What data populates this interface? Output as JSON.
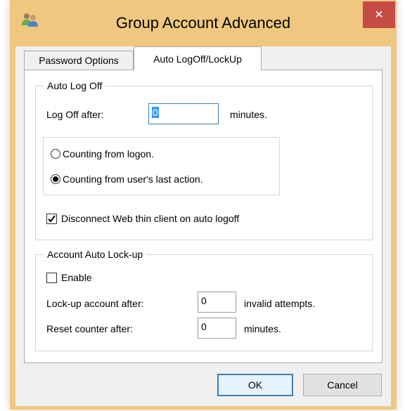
{
  "window": {
    "title": "Group Account Advanced",
    "close_glyph": "✕"
  },
  "tabs": [
    {
      "label": "Password Options",
      "active": false
    },
    {
      "label": "Auto LogOff/LockUp",
      "active": true
    }
  ],
  "auto_log_off": {
    "legend": "Auto Log Off",
    "log_off_label": "Log Off after:",
    "log_off_value": "0",
    "log_off_unit": "minutes.",
    "radio_logon": {
      "label": "Counting from logon.",
      "checked": false
    },
    "radio_last_action": {
      "label": "Counting from user's last action.",
      "checked": true
    },
    "disconnect": {
      "label": "Disconnect Web thin client on auto logoff",
      "checked": true
    }
  },
  "account_lockup": {
    "legend": "Account Auto Lock-up",
    "enable": {
      "label": "Enable",
      "checked": false
    },
    "lockup_label": "Lock-up account after:",
    "lockup_value": "0",
    "lockup_unit": "invalid attempts.",
    "reset_label": "Reset counter after:",
    "reset_value": "0",
    "reset_unit": "minutes."
  },
  "buttons": {
    "ok": "OK",
    "cancel": "Cancel"
  },
  "colors": {
    "frame": "#f0c77f",
    "close_bg": "#c74b45",
    "focus_border": "#3c7fb1",
    "selection": "#3399ff"
  }
}
